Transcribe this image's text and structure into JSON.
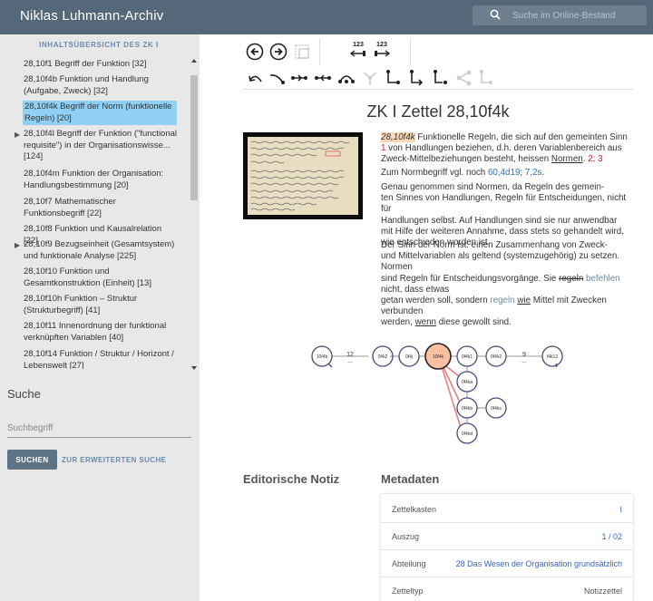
{
  "header": {
    "app_title": "Niklas Luhmann-Archiv",
    "search_placeholder": "Suche im Online-Bestand"
  },
  "sidebar": {
    "toc_title": "INHALTSÜBERSICHT DES ZK I",
    "items": [
      {
        "label": "28,10f1 Begriff der Funktion [32]"
      },
      {
        "label": "28,10f4b Funktion und Handlung (Aufgabe, Zweck) [32]"
      },
      {
        "label": "28,10f4k Begriff der Norm (funktionelle Regeln) [20]",
        "active": true
      },
      {
        "label": "28,10f4l Begriff der Funktion (\"functional requisite\") in der Organisationswisse... [124]",
        "expandable": true
      },
      {
        "label": "28,10f4m Funktion der Organisation: Handlungsbestimmung [20]"
      },
      {
        "label": "28,10f7 Mathematischer Funktionsbegriff [22]"
      },
      {
        "label": "28,10f8 Funktion und Kausalrelation [22]"
      },
      {
        "label": "28,10f9 Bezugseinheit (Gesamtsystem) und funktionale Analyse [225]",
        "expandable": true
      },
      {
        "label": "28,10f10 Funktion und Gesamtkonstruktion (Einheit) [13]"
      },
      {
        "label": "28,10f10h Funktion – Struktur (Strukturbegriff) [41]"
      },
      {
        "label": "28,10f11 Innenordnung der funktional verknüpften Variablen [40]"
      },
      {
        "label": "28,10f14 Funktion / Struktur / Horizont / Lebenswelt [27]"
      }
    ],
    "search_heading": "Suche",
    "search_placeholder": "Suchbegriff",
    "search_button": "SUCHEN",
    "advanced_link": "ZUR ERWEITERTEN SUCHE"
  },
  "toolbar": {
    "num_left": "123",
    "num_right": "123"
  },
  "zettel": {
    "title": "ZK I Zettel 28,10f4k",
    "p1_id": "28,10f4k",
    "p1_text_a": " Funktionelle Regeln, die sich auf den gemeinten Sinn ",
    "p1_ref1": "1",
    "p1_text_b": " von Handlungen beziehen, d.h. deren Variablenbereich aus Zweck-Mittelbeziehungen besteht, heissen ",
    "p1_normen": "Normen",
    "p1_colon": ". ",
    "p1_ref2": "2",
    "p1_semicolon": "; ",
    "p1_ref3": "3",
    "p2_text": "Zum Normbegriff vgl. noch ",
    "p2_link1": "60,4d19",
    "p2_sep": "; ",
    "p2_link2": "7,2s",
    "p2_end": ".",
    "p3_lines": [
      "Genau genommen sind Normen, da Regeln des gemein-",
      "ten Sinnes von Handlungen, Regeln für Entscheidungen, nicht für",
      "Handlungen selbst. Auf Handlungen sind sie nur anwendbar",
      "mit Hilfe der weiteren Annahme, dass stets so gehandelt wird,",
      "wie entschieden worden ist."
    ],
    "p4_line1": "Der Sinn der Norm ist: einen Zusammenhang von Zweck-",
    "p4_line2": "und Mittelvariablen als geltend (systemzugehörig) zu setzen. Normen",
    "p4_line3a": "sind Regeln für Entscheidungsvorgänge. Sie ",
    "p4_strike": "regeln",
    "p4_line3b": " ",
    "p4_befehlen": "befehlen",
    "p4_line3c": " nicht, dass etwas",
    "p4_line4a": "getan werden soll, sondern ",
    "p4_regeln": "regeln",
    "p4_line4b": " ",
    "p4_wie": "wie",
    "p4_line4c": " Mittel mit Zwecken verbunden",
    "p4_line5a": "werden, ",
    "p4_wenn": "wenn",
    "p4_line5b": " diese gewollt sind."
  },
  "graph": {
    "nodes": [
      "10f4b",
      "12",
      "...",
      "0f4i2",
      "0f4j",
      "10f4k",
      "0f4k1",
      "0f4k2",
      "9",
      "...",
      "f4k12",
      "0f4ka",
      "0f4kb",
      "0f4kc",
      "0f4kd"
    ]
  },
  "editorial": {
    "heading": "Editorische Notiz"
  },
  "metadata": {
    "heading": "Metadaten",
    "rows": [
      {
        "key": "Zettelkasten",
        "value": "I"
      },
      {
        "key": "Auszug",
        "value": "1 / 02"
      },
      {
        "key": "Abteilung",
        "value": "28 Das Wesen der Organisation grundsätzlich"
      },
      {
        "key": "Zetteltyp",
        "value": "Notizzettel"
      }
    ]
  },
  "colors": {
    "header_bg": "#556879",
    "sidebar_bg": "#e8e8e8",
    "active_item": "#8fd0f4",
    "link": "#2a72c8",
    "node_stroke": "#4a4a7a",
    "current_node_fill": "#f8c0a0",
    "edge_red": "#e88080"
  }
}
